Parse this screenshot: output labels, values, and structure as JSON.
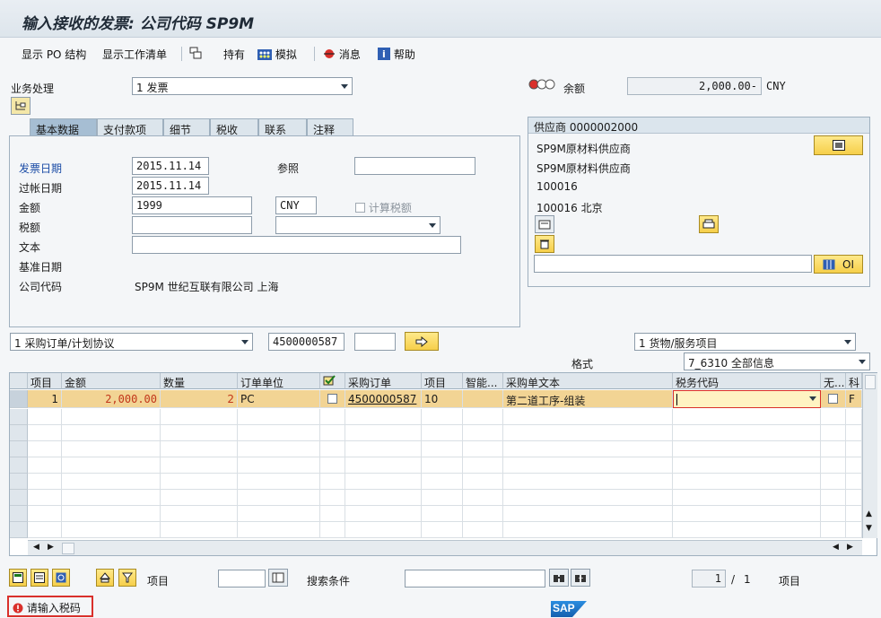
{
  "window": {
    "title": "输入接收的发票: 公司代码 SP9M"
  },
  "toolbar": {
    "show_po_structure": "显示 PO 结构",
    "show_worklist": "显示工作清单",
    "hold": "持有",
    "simulate": "模拟",
    "messages": "消息",
    "help": "帮助"
  },
  "header": {
    "transaction_label": "业务处理",
    "transaction_value": "1 发票",
    "balance_label": "余额",
    "balance_value": "2,000.00-",
    "balance_currency": "CNY"
  },
  "tabs": [
    {
      "label": "基本数据",
      "active": true
    },
    {
      "label": "支付款项",
      "active": false
    },
    {
      "label": "细节",
      "active": false
    },
    {
      "label": "税收",
      "active": false
    },
    {
      "label": "联系",
      "active": false
    },
    {
      "label": "注释",
      "active": false
    }
  ],
  "basic_data": {
    "invoice_date_label": "发票日期",
    "invoice_date": "2015.11.14",
    "reference_label": "参照",
    "reference": "",
    "posting_date_label": "过帐日期",
    "posting_date": "2015.11.14",
    "amount_label": "金额",
    "amount": "1999",
    "currency": "CNY",
    "calc_tax_label": "计算税额",
    "tax_amount_label": "税额",
    "text_label": "文本",
    "baseline_date_label": "基准日期",
    "company_code_label": "公司代码",
    "company_code_value": "SP9M 世纪互联有限公司 上海"
  },
  "vendor": {
    "header": "供应商 0000002000",
    "line1": "SP9M原材料供应商",
    "line2": "SP9M原材料供应商",
    "line3": "100016",
    "line4": "100016 北京",
    "oi_label": "OI"
  },
  "reference_bar": {
    "doc_type": "1 采购订单/计划协议",
    "po_number": "4500000587",
    "item_type": "1 货物/服务项目",
    "layout_label": "格式",
    "layout_value": "7_6310 全部信息"
  },
  "grid": {
    "columns": [
      "项目",
      "金额",
      "数量",
      "订单单位",
      "",
      "采购订单",
      "项目",
      "智能...",
      "采购单文本",
      "税务代码",
      "无...",
      "科"
    ],
    "rows": [
      {
        "item": "1",
        "amount": "2,000.00",
        "quantity": "2",
        "unit": "PC",
        "po": "4500000587",
        "po_item": "10",
        "smart": "",
        "po_text": "第二道工序-组装",
        "tax_code": "",
        "acct": "F"
      }
    ]
  },
  "footer": {
    "item_label": "项目",
    "search_label": "搜索条件",
    "page_current": "1",
    "page_sep": "/",
    "page_total": "1",
    "page_unit": "项目"
  },
  "status": {
    "message": "请输入税码"
  },
  "brand": {
    "logo_text": "SAP"
  },
  "colors": {
    "accent": "#f2d494",
    "error": "#d9302b",
    "brand": "#1a6fc9"
  }
}
